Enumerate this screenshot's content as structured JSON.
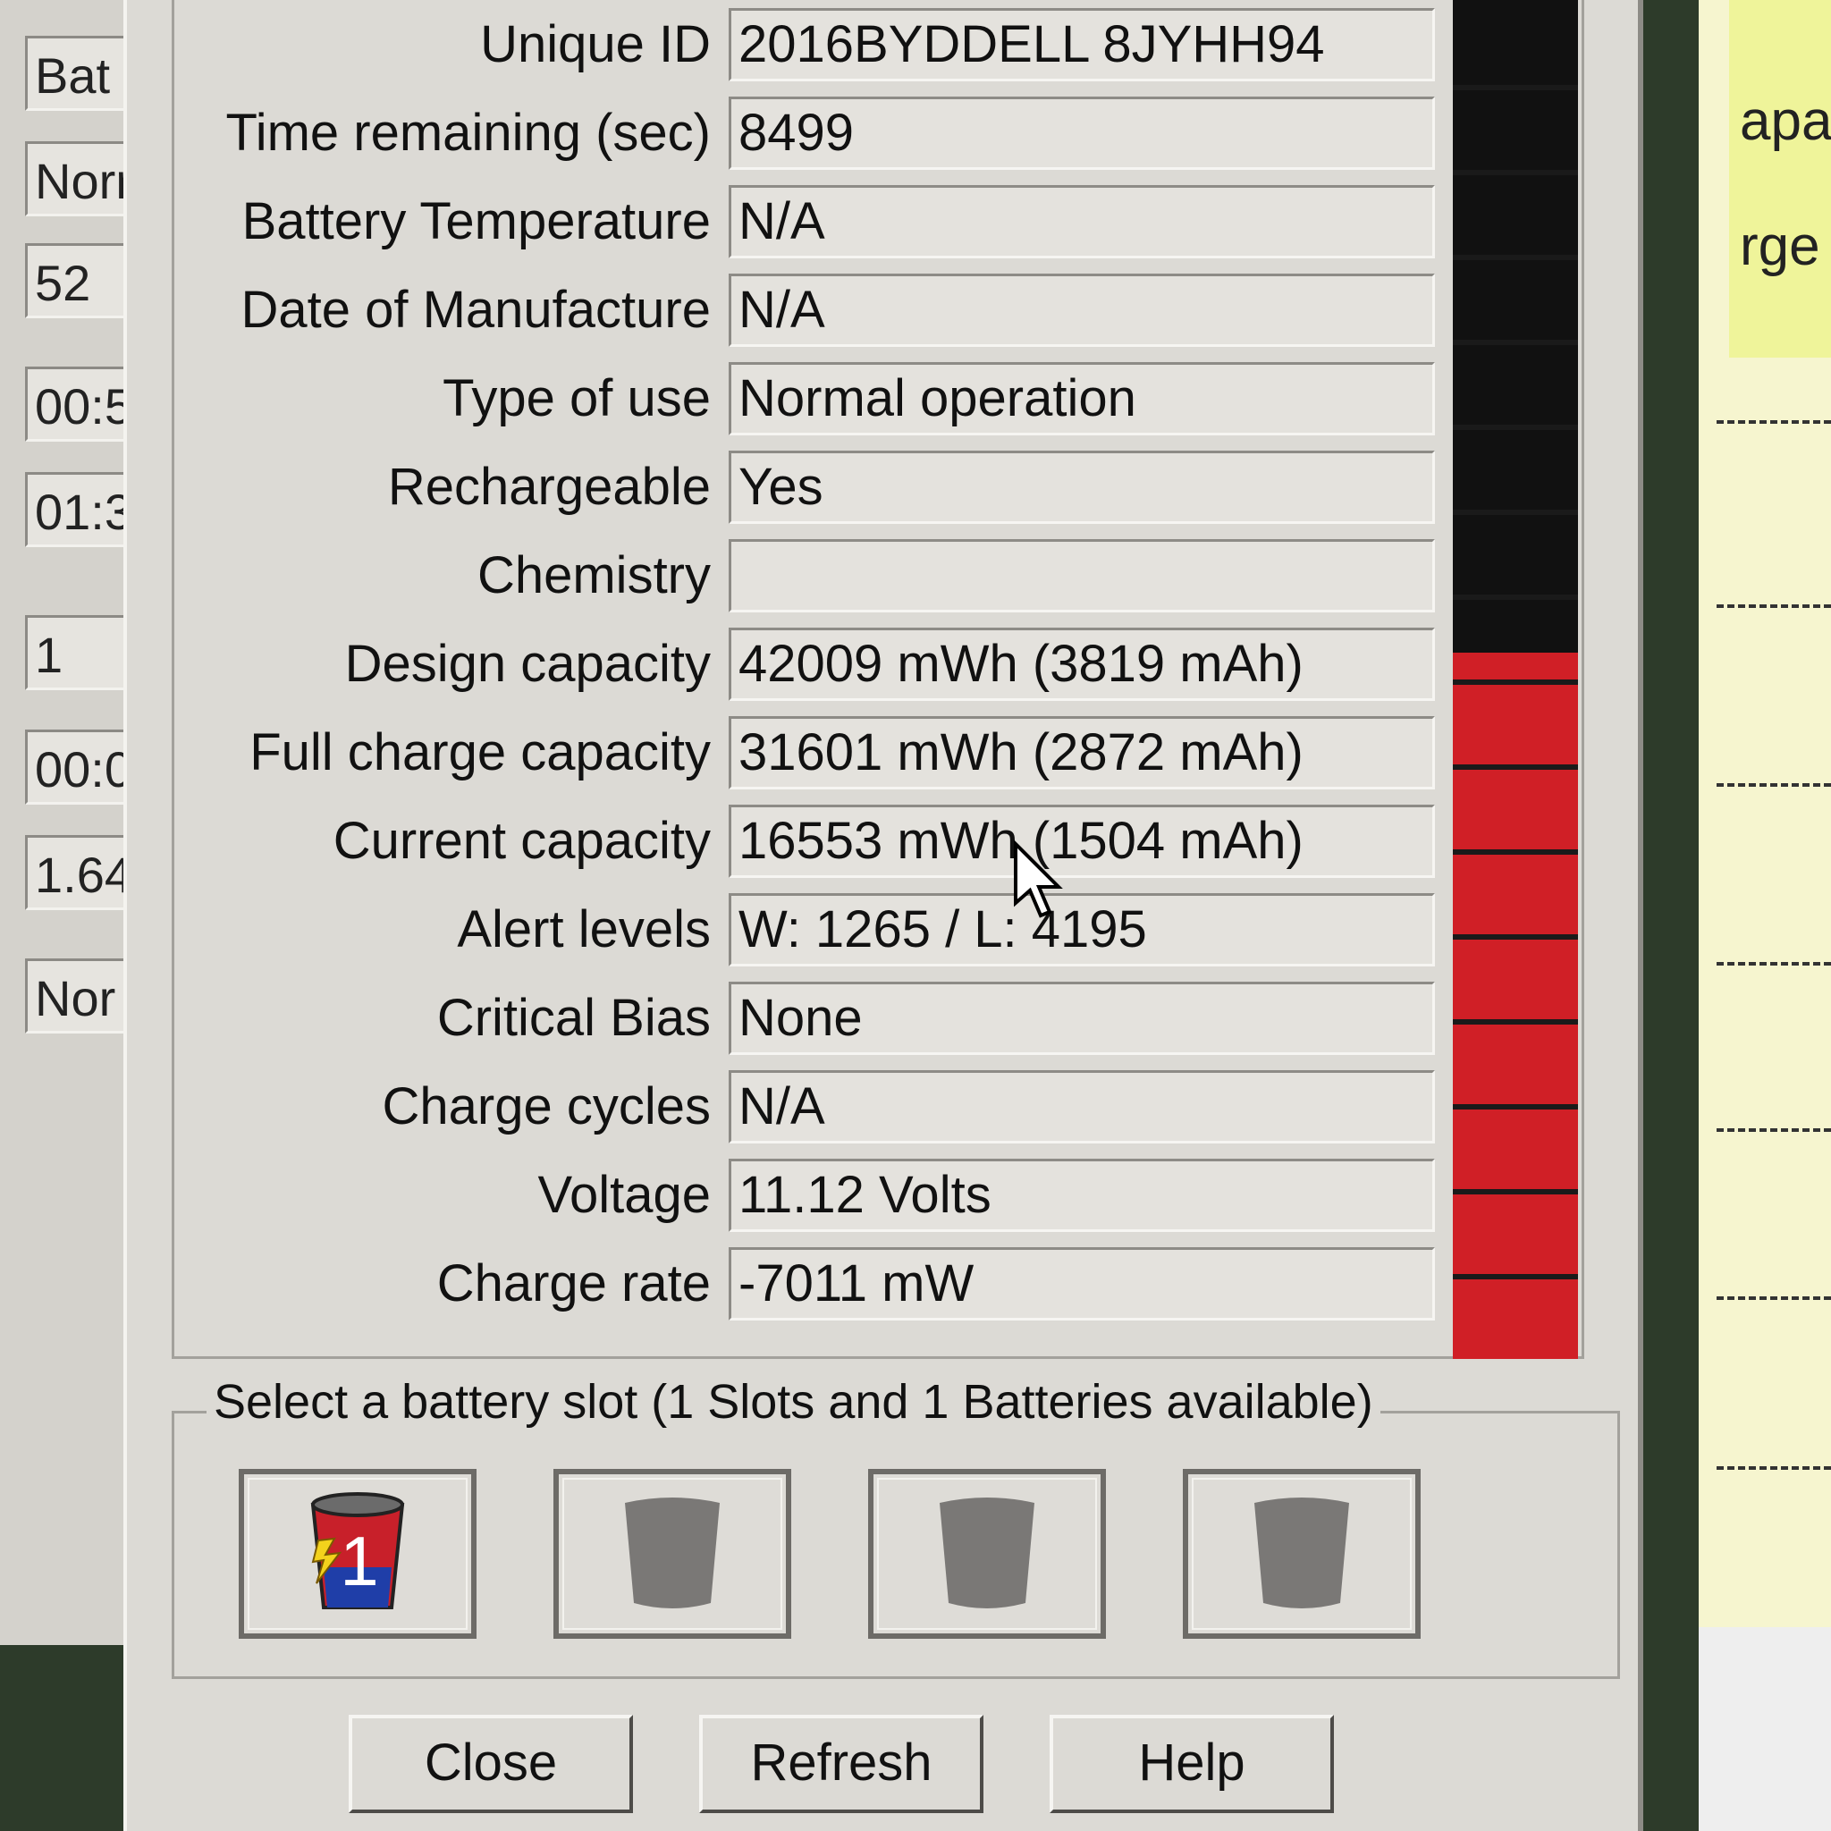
{
  "background_left": {
    "cells": [
      "Bat",
      "Norr",
      "52",
      "00:5",
      "01:3",
      "1",
      "00:0",
      "1.64",
      "Nor"
    ]
  },
  "background_right": {
    "texts": [
      "apa",
      "rge"
    ]
  },
  "properties": [
    {
      "label": "Unique ID",
      "value": "2016BYDDELL 8JYHH94"
    },
    {
      "label": "Time remaining (sec)",
      "value": "8499"
    },
    {
      "label": "Battery Temperature",
      "value": "N/A"
    },
    {
      "label": "Date of Manufacture",
      "value": "N/A"
    },
    {
      "label": "Type of use",
      "value": "Normal operation"
    },
    {
      "label": "Rechargeable",
      "value": "Yes"
    },
    {
      "label": "Chemistry",
      "value": ""
    },
    {
      "label": "Design capacity",
      "value": "42009 mWh (3819 mAh)"
    },
    {
      "label": "Full charge capacity",
      "value": "31601 mWh (2872 mAh)"
    },
    {
      "label": "Current capacity",
      "value": "16553 mWh (1504 mAh)"
    },
    {
      "label": "Alert levels",
      "value": "W: 1265 / L: 4195"
    },
    {
      "label": "Critical Bias",
      "value": "None"
    },
    {
      "label": "Charge cycles",
      "value": "N/A"
    },
    {
      "label": "Voltage",
      "value": "11.12 Volts"
    },
    {
      "label": "Charge rate",
      "value": "-7011 mW"
    }
  ],
  "gauge": {
    "charge_fraction": 0.52,
    "fill_color": "#d01f26",
    "empty_color": "#111111"
  },
  "slot_group": {
    "legend": "Select a battery slot (1 Slots and 1 Batteries available)",
    "slots": [
      {
        "number": "1",
        "icon": "battery-icon",
        "active": true
      },
      {
        "icon": "empty-battery-icon",
        "active": false
      },
      {
        "icon": "empty-battery-icon",
        "active": false
      },
      {
        "icon": "empty-battery-icon",
        "active": false
      }
    ]
  },
  "buttons": {
    "close": "Close",
    "refresh": "Refresh",
    "help": "Help"
  }
}
